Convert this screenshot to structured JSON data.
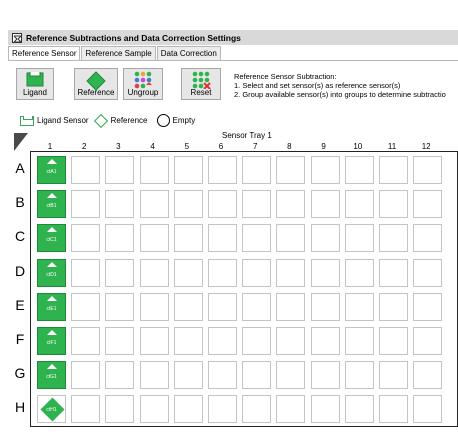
{
  "window": {
    "title": "Reference Subtractions and Data Correction Settings"
  },
  "tabs": [
    {
      "label": "Reference Sensor",
      "active": true
    },
    {
      "label": "Reference Sample",
      "active": false
    },
    {
      "label": "Data Correction",
      "active": false
    }
  ],
  "toolbar": {
    "ligand_label": "Ligand",
    "reference_label": "Reference",
    "ungroup_label": "Ungroup",
    "reset_label": "Reset"
  },
  "instructions": {
    "heading": "Reference Sensor Subtraction:",
    "step1": "1.  Select and set sensor(s) as reference sensor(s)",
    "step2": "2.  Group available sensor(s) into groups to determine subtractio"
  },
  "legend": {
    "ligand_sensor": "Ligand Sensor",
    "reference": "Reference",
    "empty": "Empty"
  },
  "tray": {
    "title": "Sensor Tray 1",
    "columns": [
      "1",
      "2",
      "3",
      "4",
      "5",
      "6",
      "7",
      "8",
      "9",
      "10",
      "11",
      "12"
    ],
    "rows": [
      "A",
      "B",
      "C",
      "D",
      "E",
      "F",
      "G",
      "H"
    ],
    "column1_wells": [
      {
        "label": "ctA1",
        "type": "ligand"
      },
      {
        "label": "ctB1",
        "type": "ligand"
      },
      {
        "label": "ctC1",
        "type": "ligand"
      },
      {
        "label": "ctD1",
        "type": "ligand"
      },
      {
        "label": "ctE1",
        "type": "ligand"
      },
      {
        "label": "ctF1",
        "type": "ligand"
      },
      {
        "label": "ctG1",
        "type": "ligand"
      },
      {
        "label": "ctH1",
        "type": "reference"
      }
    ]
  },
  "colors": {
    "accent_green": "#2fb34e",
    "title_bar": "#d9d9d9"
  }
}
